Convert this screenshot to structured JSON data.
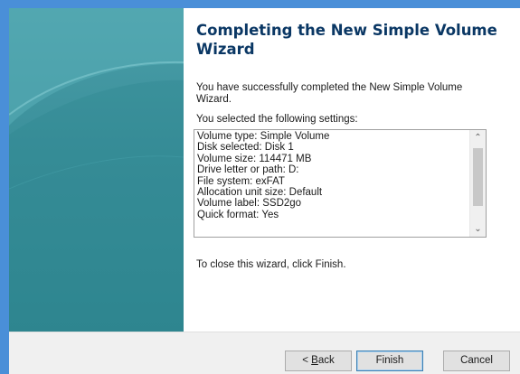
{
  "wizard": {
    "title": "Completing the New Simple Volume Wizard",
    "success_message": "You have successfully completed the New Simple Volume Wizard.",
    "settings_label": "You selected the following settings:",
    "settings": [
      "Volume type: Simple Volume",
      "Disk selected: Disk 1",
      "Volume size: 114471 MB",
      "Drive letter or path: D:",
      "File system: exFAT",
      "Allocation unit size: Default",
      "Volume label: SSD2go",
      "Quick format: Yes"
    ],
    "close_instruction": "To close this wizard, click Finish."
  },
  "buttons": {
    "back_mnemonic": "B",
    "back_rest": "ack",
    "back_prefix": "< ",
    "finish": "Finish",
    "cancel": "Cancel"
  },
  "icons": {
    "scroll_up": "chevron-up-icon",
    "scroll_down": "chevron-down-icon"
  },
  "colors": {
    "banner": "#3a8f9a",
    "title": "#0a3764",
    "frame": "#4a8fd8"
  }
}
